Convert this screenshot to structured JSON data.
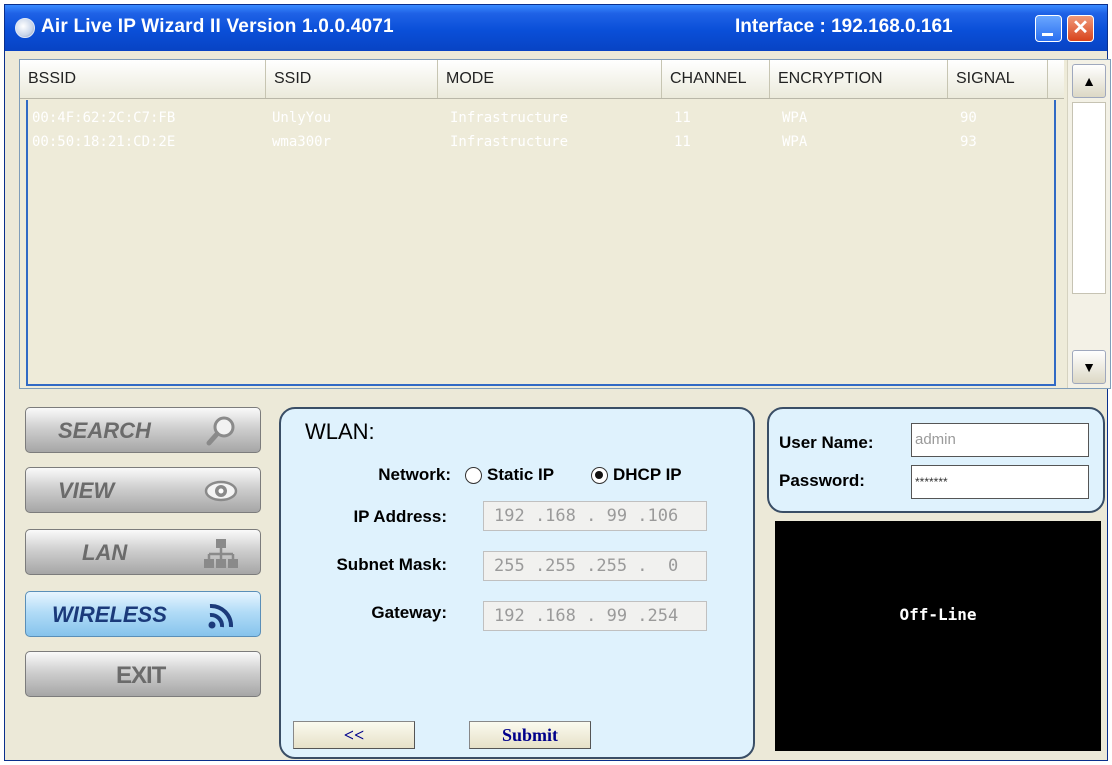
{
  "window": {
    "title": "Air Live IP Wizard II  Version 1.0.0.4071",
    "interface": "Interface : 192.168.0.161",
    "minimize_icon": "minimize-icon",
    "close_label": "✕"
  },
  "list": {
    "columns": [
      "BSSID",
      "SSID",
      "MODE",
      "CHANNEL",
      "ENCRYPTION",
      "SIGNAL"
    ],
    "rows": [
      {
        "bssid": "00:4F:62:2C:C7:FB",
        "ssid": "UnlyYou",
        "mode": "Infrastructure",
        "channel": "11",
        "encryption": "WPA",
        "signal": "90"
      },
      {
        "bssid": "00:50:18:21:CD:2E",
        "ssid": "wma300r",
        "mode": "Infrastructure",
        "channel": "11",
        "encryption": "WPA",
        "signal": "93"
      }
    ],
    "scroll_up": "▲",
    "scroll_down": "▼"
  },
  "nav": {
    "search": "SEARCH",
    "view": "VIEW",
    "lan": "LAN",
    "wireless": "WIRELESS",
    "exit": "EXIT"
  },
  "wlan": {
    "title": "WLAN:",
    "network_label": "Network:",
    "static_label": "Static IP",
    "dhcp_label": "DHCP IP",
    "selected_mode": "DHCP IP",
    "ip_label": "IP Address:",
    "ip_value": "192 .168 . 99 .106",
    "mask_label": "Subnet Mask:",
    "mask_value": "255 .255 .255 .  0",
    "gateway_label": "Gateway:",
    "gateway_value": "192 .168 . 99 .254",
    "back_label": "<<",
    "submit_label": "Submit"
  },
  "login": {
    "username_label": "User Name:",
    "username_value": "admin",
    "password_label": "Password:",
    "password_value": "*******"
  },
  "preview": {
    "status": "Off-Line"
  },
  "colors": {
    "titlebar": "#0a4fd8",
    "panel_bg": "#dff2fd",
    "list_bg": "#eeebd9",
    "active_nav": "#b2dcf7",
    "button_text": "#00008b"
  }
}
